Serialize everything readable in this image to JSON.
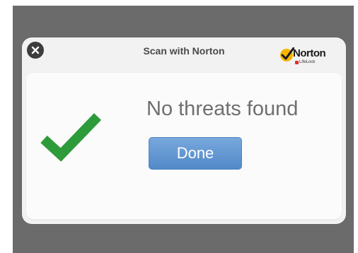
{
  "dialog": {
    "title": "Scan with Norton",
    "close_icon": "close-icon",
    "brand": {
      "name": "Norton",
      "sub": "LifeLock",
      "check_color": "#f7b500"
    },
    "status_icon": "checkmark-icon",
    "status_icon_color": "#2e9b3a",
    "status_text": "No threats found",
    "done_label": "Done"
  }
}
